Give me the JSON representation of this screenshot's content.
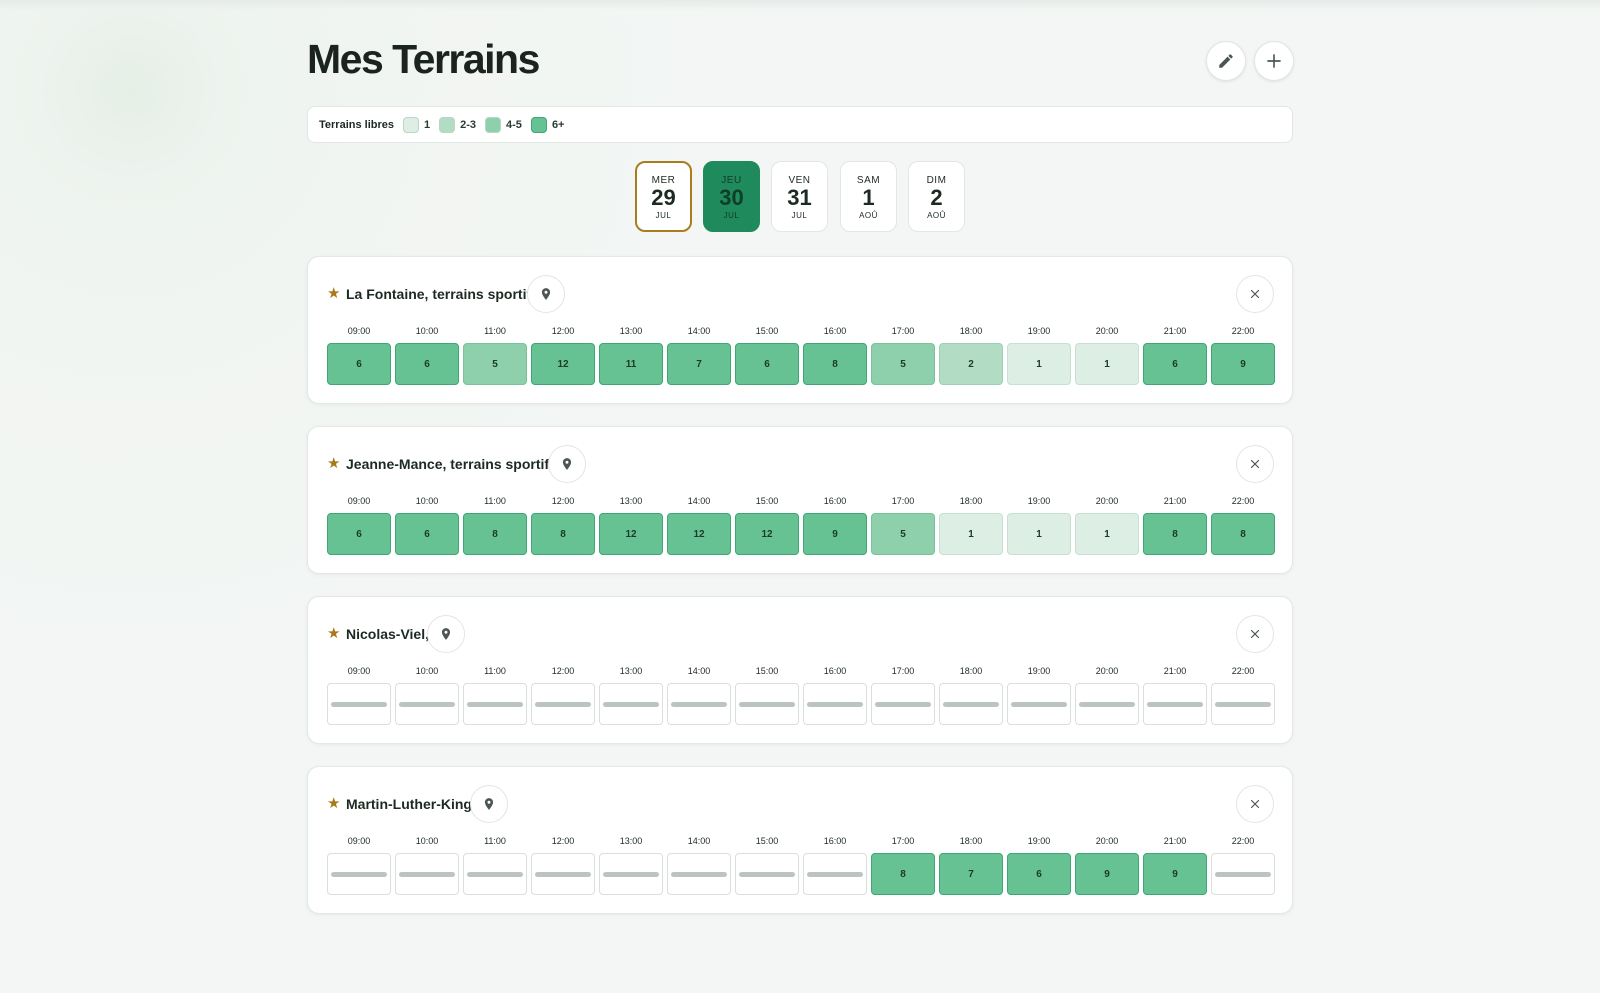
{
  "page": {
    "title": "Mes Terrains"
  },
  "icons": {
    "edit": "pencil-icon",
    "add": "plus-icon",
    "location": "map-pin-icon",
    "remove": "close-icon",
    "favorite": "star-icon"
  },
  "colors": {
    "selected_day": "#1f8a5b",
    "today_border": "#a87e1c",
    "star": "#a9781a",
    "level_1": "#ddeee5",
    "level_2_3": "#b3dcc5",
    "level_4_5": "#8dd0ab",
    "level_6_plus": "#66c293"
  },
  "legend": {
    "title": "Terrains libres",
    "items": [
      {
        "label": "1",
        "level": "l1"
      },
      {
        "label": "2-3",
        "level": "l2"
      },
      {
        "label": "4-5",
        "level": "l4"
      },
      {
        "label": "6+",
        "level": "l6"
      }
    ]
  },
  "days": [
    {
      "weekday": "MER",
      "day": "29",
      "month": "JUL",
      "today": true,
      "selected": false
    },
    {
      "weekday": "JEU",
      "day": "30",
      "month": "JUL",
      "today": false,
      "selected": true
    },
    {
      "weekday": "VEN",
      "day": "31",
      "month": "JUL",
      "today": false,
      "selected": false
    },
    {
      "weekday": "SAM",
      "day": "1",
      "month": "AOÛ",
      "today": false,
      "selected": false
    },
    {
      "weekday": "DIM",
      "day": "2",
      "month": "AOÛ",
      "today": false,
      "selected": false
    }
  ],
  "hours": [
    "09:00",
    "10:00",
    "11:00",
    "12:00",
    "13:00",
    "14:00",
    "15:00",
    "16:00",
    "17:00",
    "18:00",
    "19:00",
    "20:00",
    "21:00",
    "22:00"
  ],
  "venues": [
    {
      "name": "La Fontaine, terrains sportifs",
      "favorite": true,
      "slots": [
        6,
        6,
        5,
        12,
        11,
        7,
        6,
        8,
        5,
        2,
        1,
        1,
        6,
        9
      ]
    },
    {
      "name": "Jeanne-Mance, terrains sportifs",
      "favorite": true,
      "slots": [
        6,
        6,
        8,
        8,
        12,
        12,
        12,
        9,
        5,
        1,
        1,
        1,
        8,
        8
      ]
    },
    {
      "name": "Nicolas-Viel,",
      "favorite": true,
      "slots": [
        null,
        null,
        null,
        null,
        null,
        null,
        null,
        null,
        null,
        null,
        null,
        null,
        null,
        null
      ]
    },
    {
      "name": "Martin-Luther-King,",
      "favorite": true,
      "slots": [
        null,
        null,
        null,
        null,
        null,
        null,
        null,
        null,
        8,
        7,
        6,
        9,
        9,
        null
      ]
    }
  ]
}
